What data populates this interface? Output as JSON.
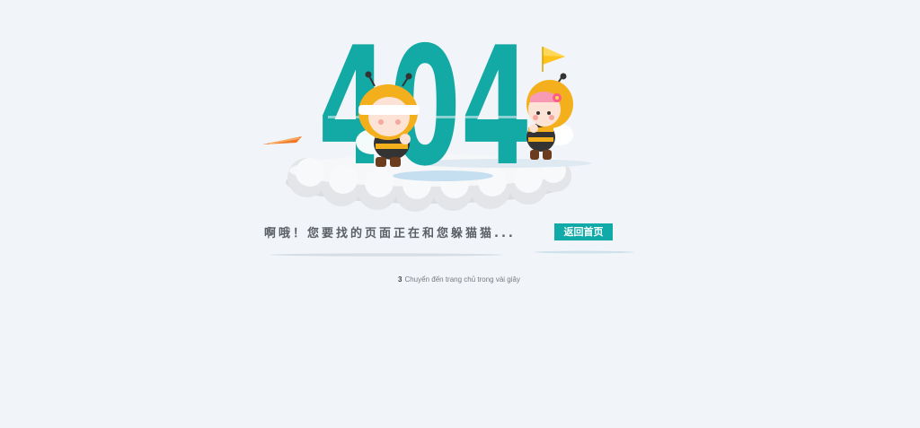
{
  "error": {
    "code": "404",
    "message": "啊哦！您要找的页面正在和您躲猫猫...",
    "button_label": "返回首页",
    "countdown": "3",
    "redirect_text": "Chuyển đến trang chủ trong vài giây"
  },
  "colors": {
    "background": "#f1f4f8",
    "accent": "#11aaa8",
    "digits": "#13a9a5",
    "bee_yellow": "#f3b01c"
  },
  "icons": {
    "flag": "yellow-flag-icon",
    "bee_left": "blindfolded-bee-icon",
    "bee_right": "peeking-bee-icon",
    "cloud": "cloud-icon"
  }
}
